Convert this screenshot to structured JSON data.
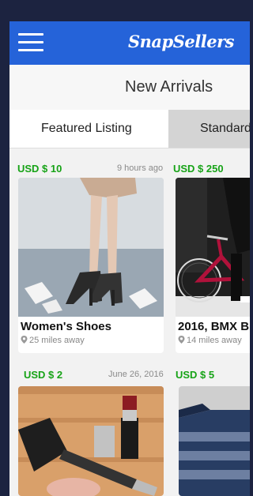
{
  "app": {
    "logo_text": "SnapSellers"
  },
  "header": {
    "section_title": "New Arrivals"
  },
  "tabs": [
    {
      "label": "Featured Listing"
    },
    {
      "label": "Standard"
    }
  ],
  "listings": [
    {
      "price": "USD $ 10",
      "time_ago": "9 hours ago",
      "title": "Women's Shoes",
      "distance": "25 miles away"
    },
    {
      "price": "USD $ 250",
      "time_ago": "",
      "title": "2016, BMX B",
      "distance": "14 miles away"
    },
    {
      "price": "USD $ 2",
      "time_ago": "June 26, 2016",
      "title": "",
      "distance": ""
    },
    {
      "price": "USD $ 5",
      "time_ago": "",
      "title": "",
      "distance": ""
    }
  ],
  "colors": {
    "topbar": "#2563d9",
    "price": "#17a317",
    "active_tab": "#ffffff",
    "inactive_tab": "#d4d4d4"
  },
  "icons": [
    "menu-icon",
    "location-pin-icon"
  ]
}
